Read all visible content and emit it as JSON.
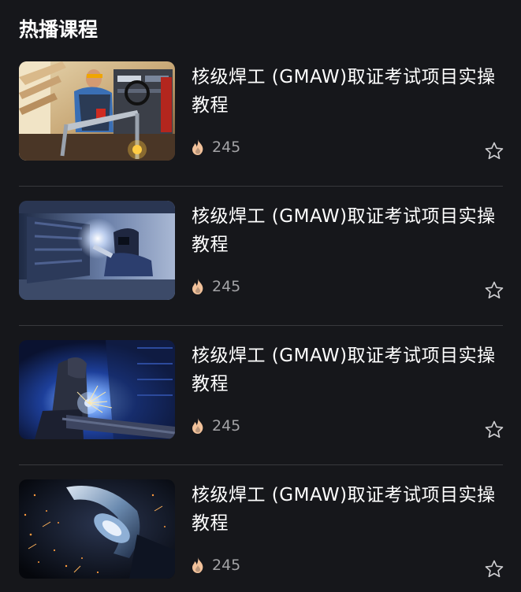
{
  "section": {
    "title": "热播课程"
  },
  "courses": [
    {
      "title": "核级焊工 (GMAW)取证考试项目实操教程",
      "plays": "245",
      "image": "welder-workshop-photo"
    },
    {
      "title": "核级焊工 (GMAW)取证考试项目实操教程",
      "plays": "245",
      "image": "welder-mask-photo"
    },
    {
      "title": "核级焊工 (GMAW)取证考试项目实操教程",
      "plays": "245",
      "image": "welding-sparks-blue-photo"
    },
    {
      "title": "核级焊工 (GMAW)取证考试项目实操教程",
      "plays": "245",
      "image": "grinding-sparks-photo"
    }
  ],
  "icons": {
    "plays": "fire-icon",
    "favorite": "star-icon"
  },
  "colors": {
    "background": "#16171b",
    "title": "#ffffff",
    "meta": "#a3a3a6",
    "fire": "#f2c29b",
    "divider": "#38393d"
  }
}
